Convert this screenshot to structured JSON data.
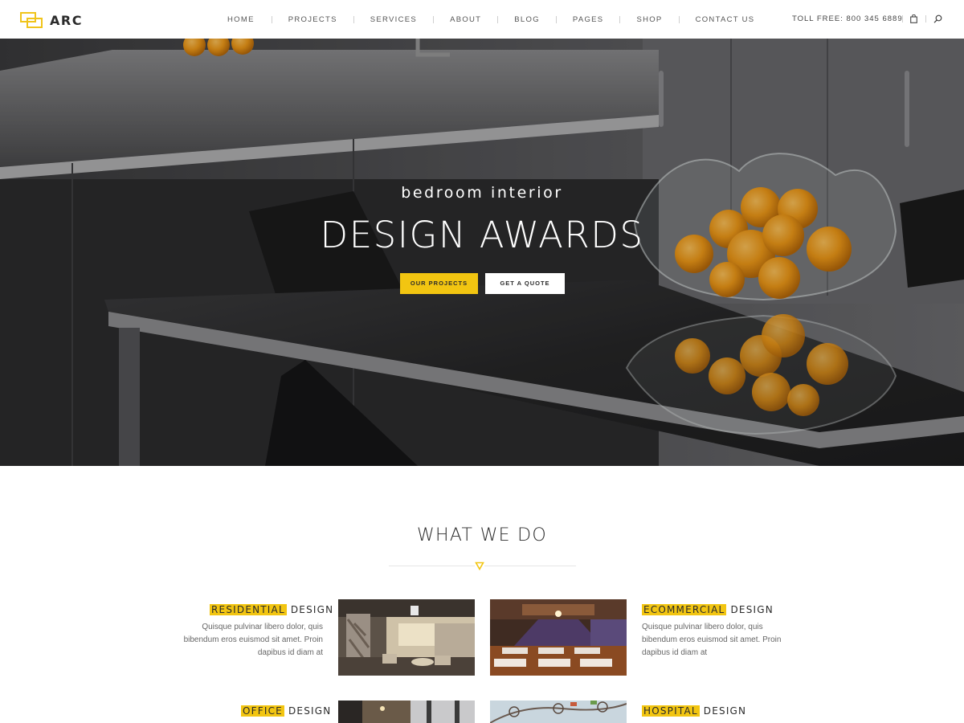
{
  "brand": {
    "name": "ARC",
    "accent": "#f2c511"
  },
  "nav": {
    "items": [
      "HOME",
      "PROJECTS",
      "SERVICES",
      "ABOUT",
      "BLOG",
      "PAGES",
      "SHOP",
      "CONTACT US"
    ],
    "toll_free": "TOLL FREE: 800 345 6889",
    "icons": [
      "shopping-bag-icon",
      "search-icon"
    ]
  },
  "hero": {
    "subtitle": "bedroom interior",
    "title": "DESIGN AWARDS",
    "buttons": {
      "primary": "OUR PROJECTS",
      "secondary": "GET A QUOTE"
    }
  },
  "services": {
    "heading": "WHAT WE DO",
    "items": [
      {
        "highlight": "RESIDENTIAL",
        "rest": "DESIGN",
        "text": "Quisque pulvinar libero dolor, quis bibendum eros euismod sit amet. Proin dapibus id diam at"
      },
      {
        "highlight": "ECOMMERCIAL",
        "rest": "DESIGN",
        "text": "Quisque pulvinar libero dolor, quis bibendum eros euismod sit amet. Proin dapibus id diam at"
      },
      {
        "highlight": "OFFICE",
        "rest": "DESIGN"
      },
      {
        "highlight": "HOSPITAL",
        "rest": "DESIGN"
      }
    ]
  }
}
